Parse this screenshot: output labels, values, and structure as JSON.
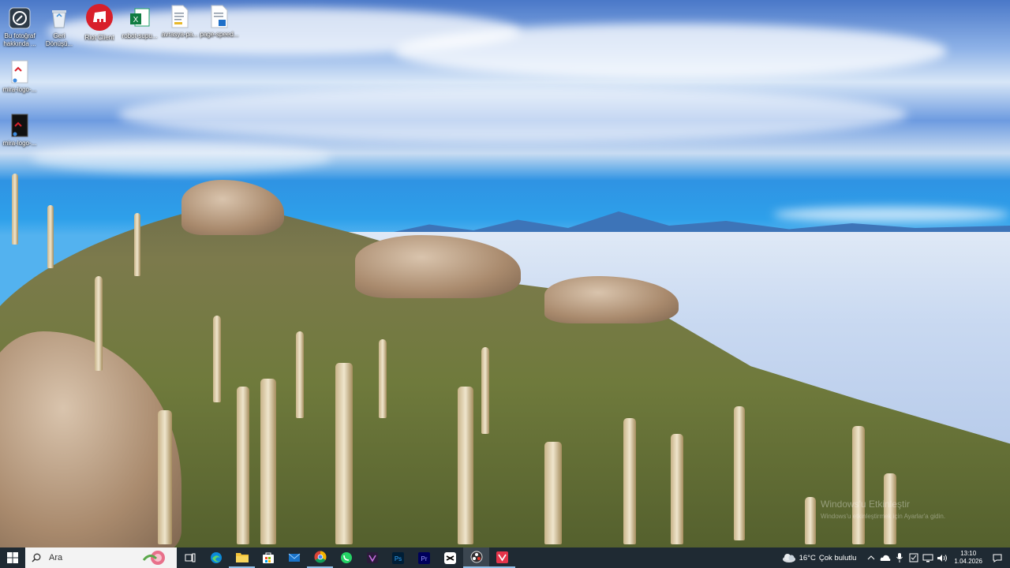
{
  "desktop_icons": [
    {
      "label": "Bu fotoğraf hakkında ...",
      "icon": "camera-info-icon"
    },
    {
      "label": "Geri Dönüşü...",
      "icon": "recycle-bin-icon"
    },
    {
      "label": "Riot Client",
      "icon": "riot-client-icon"
    },
    {
      "label": "robot-supu...",
      "icon": "excel-file-icon"
    },
    {
      "label": "avrasya-pa...",
      "icon": "text-file-icon"
    },
    {
      "label": "page-speed...",
      "icon": "image-file-icon"
    },
    {
      "label": "mira-logo-...",
      "icon": "image-file-icon"
    },
    {
      "label": "mira-logo-...",
      "icon": "image-file-icon"
    }
  ],
  "taskbar": {
    "search_placeholder": "Ara",
    "apps": [
      "start-icon",
      "task-view-icon",
      "edge-icon",
      "file-explorer-icon",
      "store-icon",
      "mail-icon",
      "chrome-icon",
      "whatsapp-icon",
      "vectr-icon",
      "photoshop-icon",
      "premiere-icon",
      "capcut-icon",
      "obs-icon",
      "vsdc-icon"
    ]
  },
  "tray": {
    "weather_temp": "16°C",
    "weather_text": "Çok bulutlu",
    "time": "13:10",
    "date": "1.04.2026"
  },
  "watermark": {
    "line1": "Windows'u Etkinleştir",
    "line2": "Windows'u etkinleştirmek için Ayarlar'a gidin."
  },
  "colors": {
    "taskbar": "#1f2a33",
    "accent": "#8fbfe8"
  }
}
